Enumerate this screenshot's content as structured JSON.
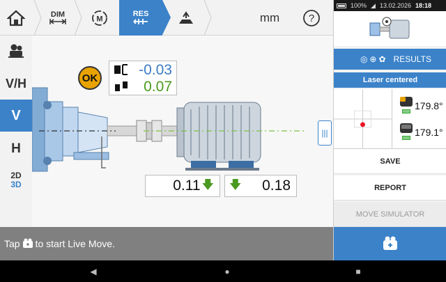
{
  "toolbar": {
    "home_icon": "home-icon",
    "dim_label": "DIM",
    "measure_icon": "measure-m-icon",
    "res_label": "RES",
    "move_icon": "move-icon",
    "units": "mm",
    "help_label": "?"
  },
  "left_tabs": {
    "camera_icon": "camera-machine-icon",
    "vh": "V/H",
    "v": "V",
    "h": "H",
    "d2": "2D",
    "d3": "3D"
  },
  "canvas": {
    "status_ok": "OK",
    "coupling": {
      "gap": "-0.03",
      "offset": "0.07"
    },
    "foot_values": {
      "front": "0.11",
      "back": "0.18"
    },
    "handle_icon": "panel-handle-icon",
    "colors": {
      "accent": "#3b82c9",
      "good": "#4a9a1f",
      "ok_badge": "#e9a300"
    }
  },
  "status": {
    "prefix": "Tap",
    "suffix": "to start Live Move."
  },
  "right_panel": {
    "sys": {
      "battery": "100%",
      "date": "13.02.2026",
      "time": "18:18"
    },
    "results_label": "RESULTS",
    "laser_status": "Laser centered",
    "sensor1": "179.8°",
    "sensor2": "179.1°",
    "save": "SAVE",
    "report": "REPORT",
    "move_simulator": "MOVE SIMULATOR",
    "live_move_icon": "live-move-icon"
  },
  "nav": {
    "back": "◀",
    "home": "●",
    "recent": "■"
  }
}
